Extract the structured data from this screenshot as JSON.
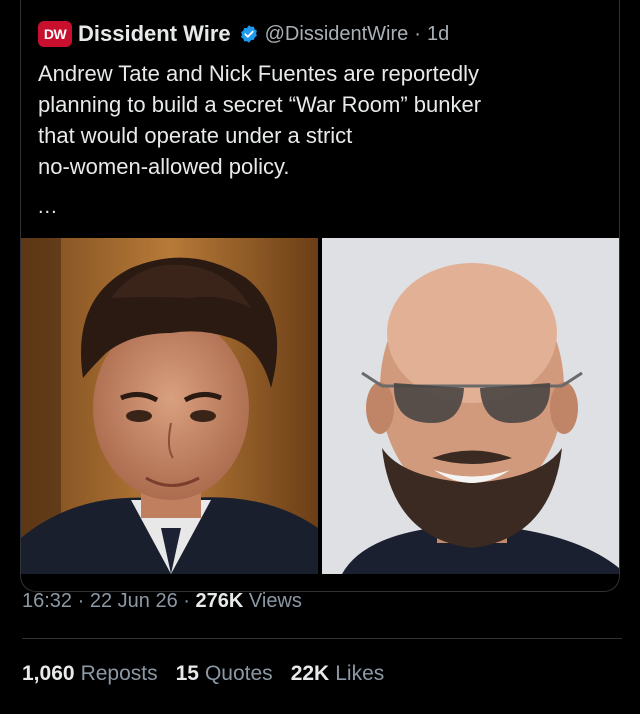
{
  "tweet": {
    "avatar_text": "DW",
    "display_name": "Dissident Wire",
    "handle": "@DissidentWire",
    "separator": "·",
    "age": "1d",
    "text": "Andrew Tate and Nick Fuentes are reportedly\nplanning to build a secret “War Room” bunker\nthat would operate under a strict\nno-women-allowed policy.",
    "more": "...",
    "time": "16:32",
    "date": "22 Jun 26",
    "views_count": "276K",
    "views_label": "Views"
  },
  "stats": {
    "reposts_count": "1,060",
    "reposts_label": "Reposts",
    "quotes_count": "15",
    "quotes_label": "Quotes",
    "likes_count": "22K",
    "likes_label": "Likes"
  },
  "colors": {
    "brand": "#c8102e",
    "verified": "#1d9bf0",
    "background": "#000000",
    "muted": "#8b98a5"
  },
  "icons": {
    "verified": "verified-badge-icon"
  }
}
